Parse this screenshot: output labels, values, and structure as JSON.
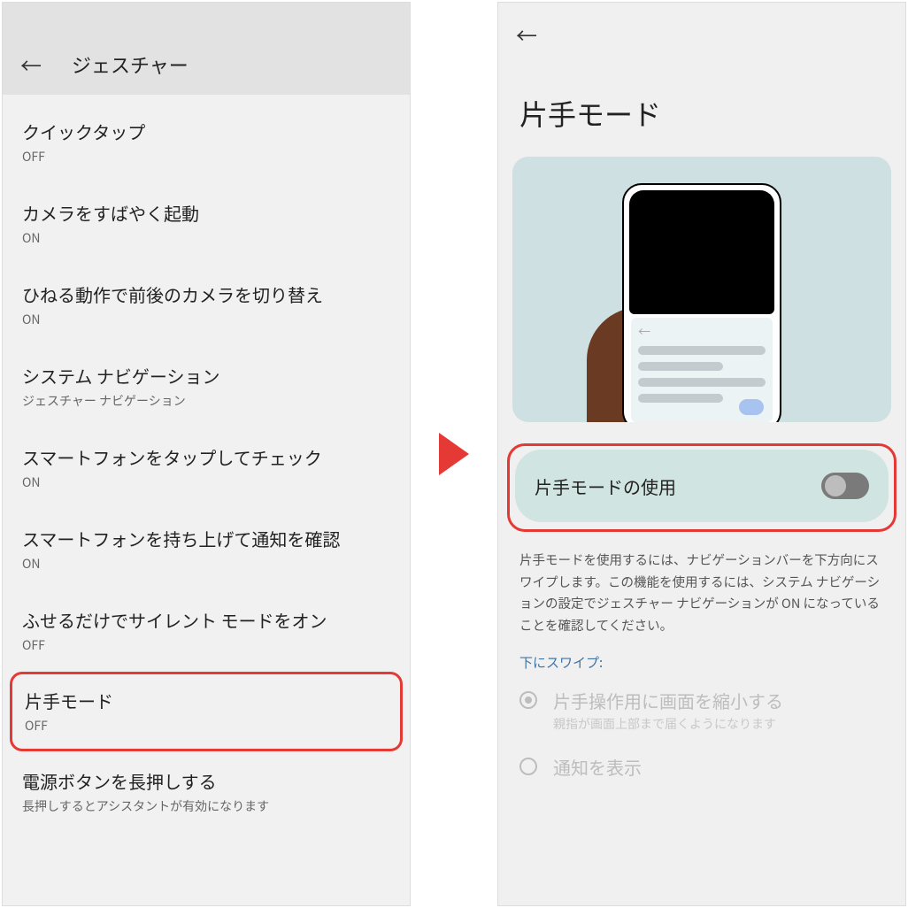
{
  "left": {
    "title": "ジェスチャー",
    "items": [
      {
        "title": "クイックタップ",
        "sub": "OFF"
      },
      {
        "title": "カメラをすばやく起動",
        "sub": "ON"
      },
      {
        "title": "ひねる動作で前後のカメラを切り替え",
        "sub": "ON"
      },
      {
        "title": "システム ナビゲーション",
        "sub": "ジェスチャー ナビゲーション"
      },
      {
        "title": "スマートフォンをタップしてチェック",
        "sub": "ON"
      },
      {
        "title": "スマートフォンを持ち上げて通知を確認",
        "sub": "ON"
      },
      {
        "title": "ふせるだけでサイレント モードをオン",
        "sub": "OFF"
      },
      {
        "title": "片手モード",
        "sub": "OFF"
      },
      {
        "title": "電源ボタンを長押しする",
        "sub": "長押しするとアシスタントが有効になります"
      }
    ]
  },
  "right": {
    "pageTitle": "片手モード",
    "toggleLabel": "片手モードの使用",
    "description": "片手モードを使用するには、ナビゲーションバーを下方向にスワイプします。この機能を使用するには、システム ナビゲーションの設定でジェスチャー ナビゲーションが ON になっていることを確認してください。",
    "swipeHeader": "下にスワイプ:",
    "options": [
      {
        "title": "片手操作用に画面を縮小する",
        "sub": "親指が画面上部まで届くようになります"
      },
      {
        "title": "通知を表示",
        "sub": ""
      }
    ]
  }
}
